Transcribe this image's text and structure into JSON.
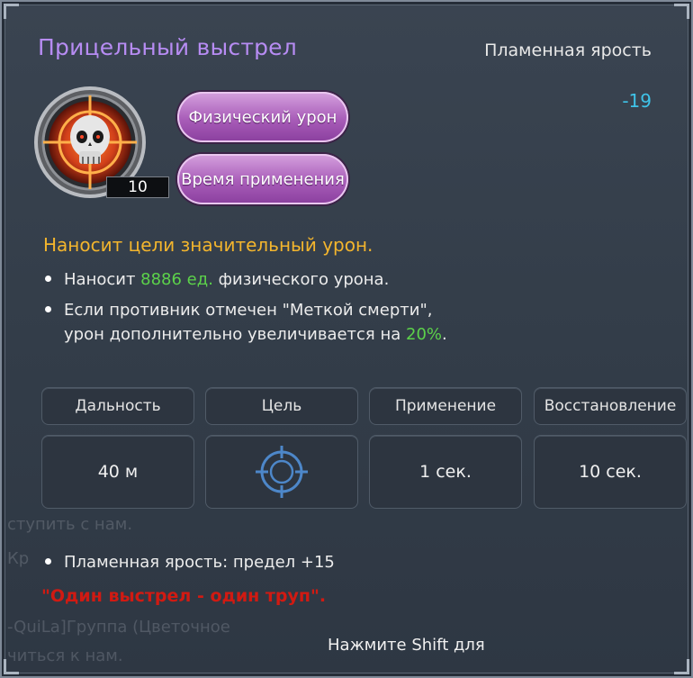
{
  "skill": {
    "name": "Прицельный выстрел",
    "stance": "Пламенная ярость",
    "cost": "-19",
    "level": "10",
    "tags": [
      "Физический урон",
      "Время применения"
    ],
    "description": "Наносит цели значительный урон.",
    "bullets": {
      "b1_pre": "Наносит ",
      "b1_value": "8886 ед.",
      "b1_post": " физического урона.",
      "b2_line1": "Если противник отмечен \"Меткой смерти\",",
      "b2_pre": "урон дополнительно увеличивается на ",
      "b2_value": "20%",
      "b2_post": "."
    }
  },
  "stats": {
    "headers": [
      "Дальность",
      "Цель",
      "Применение",
      "Восстановление"
    ],
    "values": [
      "40 м",
      "",
      "1 сек.",
      "10 сек."
    ]
  },
  "rage_bonus": "Пламенная ярость: предел +15",
  "quote": "\"Один выстрел - один труп\".",
  "hint": "Нажмите Shift для",
  "background_chat": [
    "ступить с нам.",
    "ится к нам.",
    "Кр                ",
    "-QuiLa]Группа  (Цветочное",
    "читься к нам."
  ],
  "icons": {
    "skill": "skull-crosshair-icon",
    "target": "crosshair-target-icon"
  },
  "colors": {
    "title": "#b78cf3",
    "description": "#f3b52d",
    "highlight": "#5cd24a",
    "cost": "#3fc3e8",
    "quote": "#d11a12"
  }
}
